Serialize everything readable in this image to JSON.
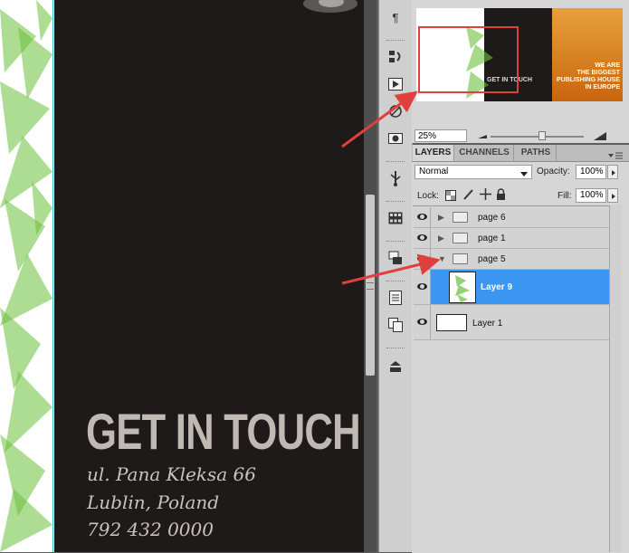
{
  "canvas": {
    "heading": "GET IN TOUCH",
    "address_line1": "ul. Pana Kleksa 66",
    "address_line2": "Lublin, Poland",
    "phone": "792 432 0000"
  },
  "navigator": {
    "zoom": "25%",
    "thumb_left_text": "GET IN TOUCH",
    "thumb_right_line1": "WE ARE",
    "thumb_right_line2": "THE BIGGEST",
    "thumb_right_line3": "PUBLISHING HOUSE",
    "thumb_right_line4": "IN EUROPE"
  },
  "layers_panel": {
    "tabs": [
      "LAYERS",
      "CHANNELS",
      "PATHS"
    ],
    "blend_mode": "Normal",
    "opacity_label": "Opacity:",
    "opacity_value": "100%",
    "lock_label": "Lock:",
    "fill_label": "Fill:",
    "fill_value": "100%",
    "layers": [
      {
        "name": "page 6",
        "type": "group",
        "expanded": false
      },
      {
        "name": "page 1",
        "type": "group",
        "expanded": false
      },
      {
        "name": "page 5",
        "type": "group",
        "expanded": true
      },
      {
        "name": "Layer 9",
        "type": "layer",
        "selected": true
      },
      {
        "name": "Layer 1",
        "type": "layer",
        "selected": false
      }
    ]
  },
  "tools": [
    "paragraph-icon",
    "history-icon",
    "actions-play-icon",
    "brush-icon",
    "camera-icon",
    "usb-icon",
    "swatches-grid-icon",
    "clone-source-icon",
    "document-icon",
    "copy-icon",
    "stamp-icon"
  ],
  "colors": {
    "selection": "#3c97f3",
    "arrow": "#e0403d",
    "leaf_green": "#6abf3a",
    "dark_page": "#1d1a19"
  }
}
